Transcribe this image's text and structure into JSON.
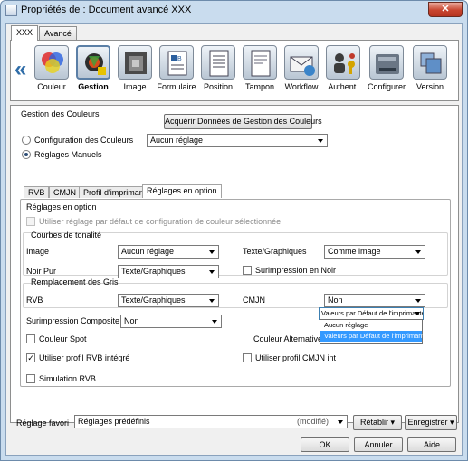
{
  "window": {
    "title": "Propriétés de : Document avancé XXX",
    "close_glyph": "✕"
  },
  "top_tabs": [
    "XXX",
    "Avancé"
  ],
  "ribbon": {
    "left_arrow": "«",
    "items": [
      "Couleur",
      "Gestion",
      "Image",
      "Formulaire",
      "Position",
      "Tampon",
      "Workflow",
      "Authent.",
      "Configurer",
      "Version"
    ],
    "selected": "Gestion"
  },
  "panel": {
    "section_title": "Gestion des Couleurs",
    "acquire_button": "Acquérir Données de Gestion des Couleurs",
    "radio_config": "Configuration des Couleurs",
    "config_select": "Aucun réglage",
    "radio_manual": "Réglages Manuels",
    "subtabs": [
      "RVB",
      "CMJN",
      "Profil d'imprimante",
      "Réglages en option"
    ],
    "options": {
      "title": "Réglages en option",
      "use_default_checkbox": "Utiliser réglage par défaut de configuration de couleur sélectionnée",
      "tone_curves": "Courbes de tonalité",
      "image_label": "Image",
      "image_value": "Aucun réglage",
      "text_graphics_label": "Texte/Graphiques",
      "text_graphics_value": "Comme image",
      "pure_black_label": "Noir Pur",
      "pure_black_value": "Texte/Graphiques",
      "overprint_black": "Surimpression en Noir",
      "gray_replacement": "Remplacement des Gris",
      "rvb_label": "RVB",
      "rvb_value": "Texte/Graphiques",
      "cmjn_label": "CMJN",
      "cmjn_value": "Non",
      "composite_overprint_label": "Surimpression Composite",
      "composite_overprint_value": "Non",
      "spot_color": "Couleur Spot",
      "alt_color_label": "Couleur Alternative",
      "alt_color_value": "Valeurs par Défaut de l'imprimante",
      "alt_color_options": [
        "Aucun réglage",
        "Valeurs par Défaut de l'imprimante"
      ],
      "use_rvb_profile": "Utiliser profil RVB intégré",
      "use_cmjn_profile": "Utiliser profil CMJN int",
      "rvb_simulation": "Simulation RVB"
    }
  },
  "footer": {
    "fav_label": "Réglage favori",
    "fav_value": "Réglages prédéfinis",
    "modified": "(modifié)",
    "restore": "Rétablir",
    "save": "Enregistrer",
    "ok": "OK",
    "cancel": "Annuler",
    "help": "Aide"
  }
}
